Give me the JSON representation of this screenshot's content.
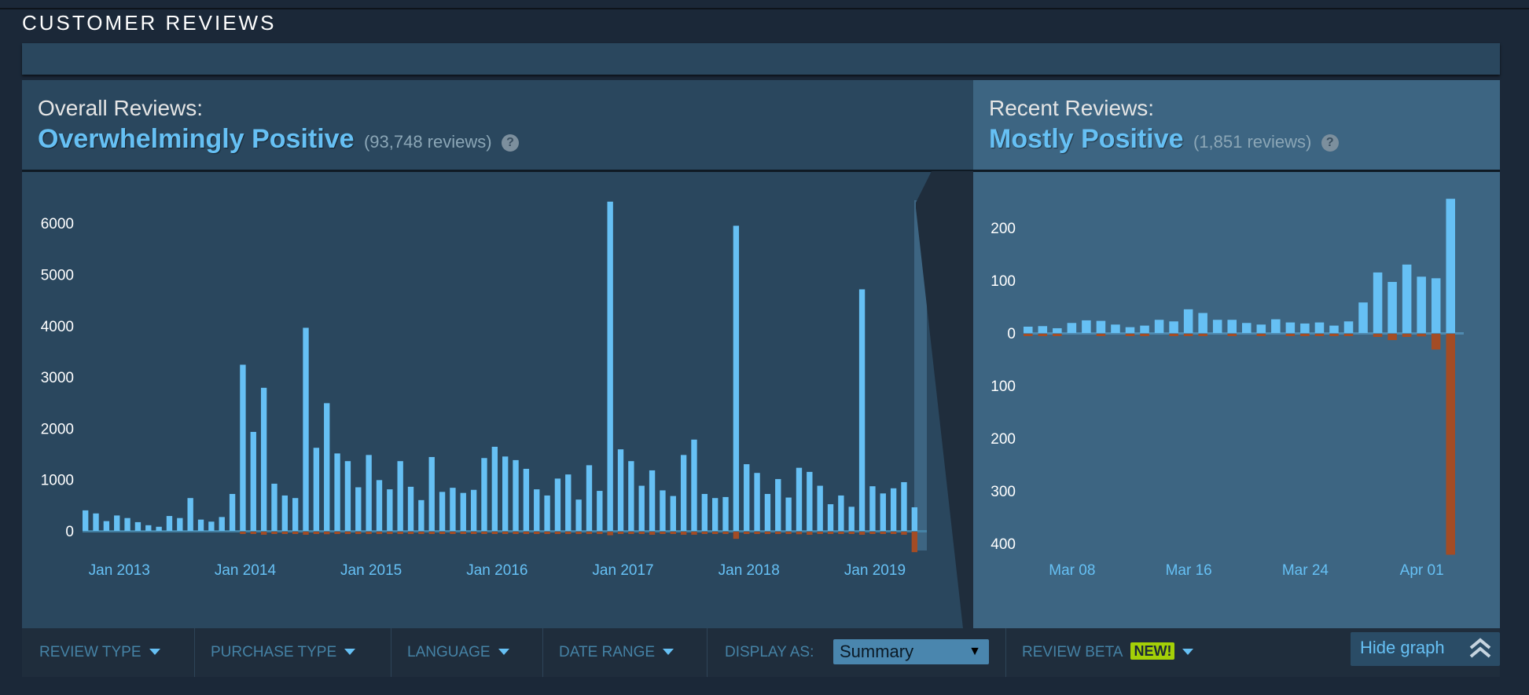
{
  "section": {
    "title": "CUSTOMER REVIEWS"
  },
  "overall": {
    "label": "Overall Reviews:",
    "summary": "Overwhelmingly Positive",
    "count": "(93,748 reviews)",
    "help": "?"
  },
  "recent": {
    "label": "Recent Reviews:",
    "summary": "Mostly Positive",
    "count": "(1,851 reviews)",
    "help": "?"
  },
  "filters": {
    "review_type": "REVIEW TYPE",
    "purchase_type": "PURCHASE TYPE",
    "language": "LANGUAGE",
    "date_range": "DATE RANGE",
    "display_as": "DISPLAY AS:",
    "display_value": "Summary",
    "review_beta": "REVIEW BETA",
    "new_badge": "NEW!",
    "hide_graph": "Hide graph"
  },
  "colors": {
    "positive": "#66c0f4",
    "negative": "#a34c25",
    "accent": "#66c0f4",
    "badge": "#a4d007"
  },
  "chart_data": [
    {
      "type": "bar",
      "title": "Overall Reviews",
      "xlabel": "",
      "ylabel": "",
      "ylim": [
        0,
        6500
      ],
      "yticks": [
        "6000",
        "5000",
        "4000",
        "3000",
        "2000",
        "1000",
        "0"
      ],
      "xtick_labels": [
        "Jan 2013",
        "Jan 2014",
        "Jan 2015",
        "Jan 2016",
        "Jan 2017",
        "Jan 2018",
        "Jan 2019"
      ],
      "xtick_index": [
        3,
        15,
        27,
        39,
        51,
        63,
        75
      ],
      "series": [
        {
          "name": "Positive",
          "values": [
            400,
            340,
            190,
            300,
            250,
            170,
            110,
            80,
            290,
            250,
            640,
            220,
            180,
            270,
            720,
            3240,
            1930,
            2790,
            920,
            690,
            640,
            3960,
            1620,
            2490,
            1510,
            1360,
            850,
            1480,
            990,
            810,
            1360,
            860,
            600,
            1440,
            760,
            840,
            740,
            800,
            1420,
            1640,
            1450,
            1380,
            1210,
            810,
            690,
            1020,
            1100,
            610,
            1280,
            780,
            6420,
            1590,
            1360,
            880,
            1180,
            790,
            680,
            1480,
            1780,
            720,
            640,
            660,
            5950,
            1300,
            1130,
            720,
            1010,
            650,
            1230,
            1150,
            880,
            520,
            690,
            470,
            4710,
            870,
            730,
            830,
            950,
            460
          ]
        },
        {
          "name": "Negative",
          "values": [
            0,
            0,
            0,
            0,
            0,
            0,
            0,
            0,
            0,
            0,
            0,
            0,
            0,
            0,
            0,
            30,
            20,
            60,
            20,
            15,
            10,
            60,
            30,
            50,
            30,
            40,
            20,
            40,
            30,
            20,
            30,
            20,
            15,
            30,
            20,
            20,
            15,
            20,
            30,
            40,
            30,
            40,
            30,
            20,
            15,
            20,
            30,
            20,
            40,
            20,
            70,
            40,
            40,
            30,
            60,
            30,
            30,
            60,
            60,
            30,
            20,
            20,
            140,
            40,
            40,
            30,
            40,
            30,
            50,
            60,
            40,
            30,
            40,
            30,
            60,
            30,
            40,
            40,
            60,
            400
          ]
        }
      ]
    },
    {
      "type": "bar",
      "title": "Recent Reviews",
      "xlabel": "",
      "ylabel": "",
      "ylim": [
        -420,
        260
      ],
      "yticks": [
        "200",
        "100",
        "0",
        "100",
        "200",
        "300",
        "400"
      ],
      "xtick_labels": [
        "Mar 08",
        "Mar 16",
        "Mar 24",
        "Apr 01"
      ],
      "xtick_index": [
        3,
        11,
        19,
        27
      ],
      "series": [
        {
          "name": "Positive",
          "values": [
            12,
            13,
            9,
            19,
            24,
            23,
            16,
            11,
            14,
            25,
            22,
            45,
            38,
            25,
            25,
            19,
            16,
            26,
            20,
            18,
            20,
            14,
            22,
            58,
            115,
            97,
            130,
            107,
            104,
            255
          ]
        },
        {
          "name": "Negative",
          "values": [
            2,
            3,
            2,
            0,
            0,
            4,
            0,
            2,
            3,
            0,
            3,
            4,
            2,
            0,
            2,
            0,
            2,
            0,
            2,
            2,
            2,
            2,
            2,
            0,
            6,
            12,
            6,
            5,
            30,
            420
          ]
        }
      ]
    }
  ]
}
